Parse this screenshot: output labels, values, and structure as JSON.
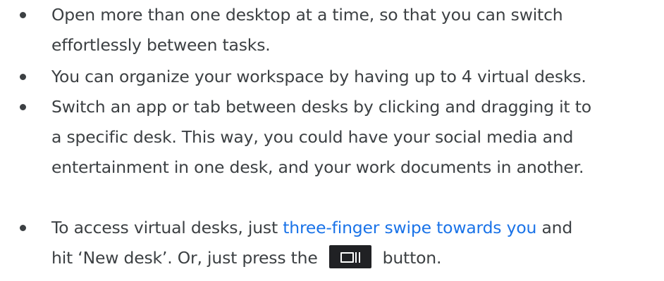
{
  "bullets": [
    {
      "lines": [
        "Open more than one desktop at a time, so that you can switch",
        "effortlessly between tasks."
      ]
    },
    {
      "lines": [
        "You can organize your workspace by having up to 4 virtual desks."
      ]
    },
    {
      "lines": [
        "Switch an app or tab between desks by clicking and dragging it to",
        "a specific desk. This way, you could have your social media and",
        "entertainment in one desk, and your work documents in another."
      ]
    },
    {
      "line1_before_link": "To access virtual desks, just ",
      "link_text": "three-finger swipe towards you",
      "line1_after_link": " and",
      "line2_before_key": "hit ‘New desk’. Or, just press the",
      "line2_after_key": "button."
    }
  ],
  "icons": {
    "bullet": "bullet-dot-icon",
    "overview_key": "overview-key-icon"
  },
  "colors": {
    "text": "#3c4043",
    "link": "#1a73e8",
    "key_background": "#202124",
    "key_glyph": "#ffffff"
  }
}
